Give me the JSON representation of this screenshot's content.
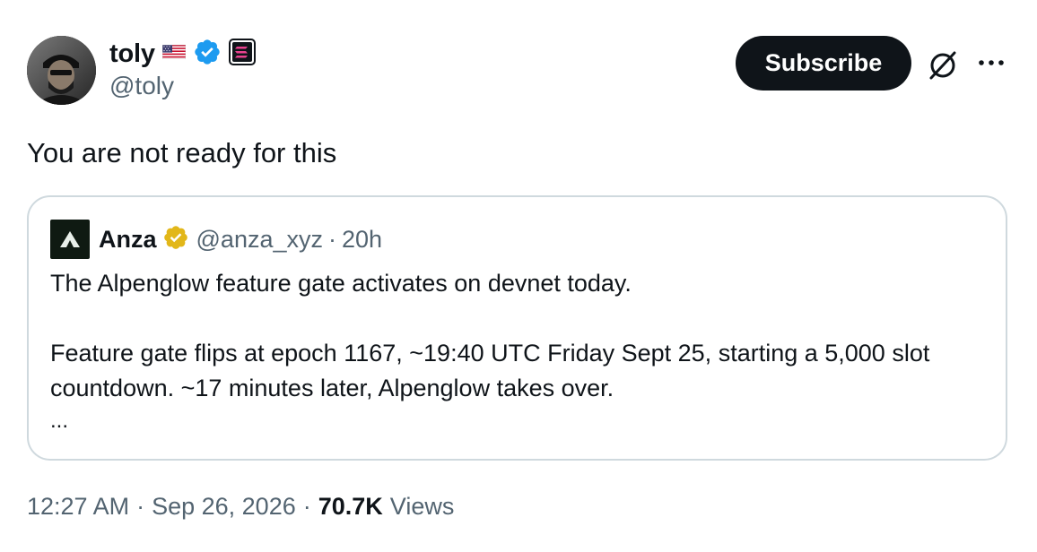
{
  "author": {
    "display_name": "toly",
    "handle": "@toly"
  },
  "header": {
    "subscribe_label": "Subscribe"
  },
  "tweet": {
    "text": "You are not ready for this"
  },
  "quote": {
    "display_name": "Anza",
    "handle": "@anza_xyz",
    "separator": "·",
    "time": "20h",
    "paragraph_1": "The Alpenglow feature gate activates on devnet today.",
    "paragraph_2": "Feature gate flips at epoch 1167, ~19:40 UTC Friday Sept 25, starting a 5,000 slot countdown. ~17 minutes later, Alpenglow takes over.",
    "ellipsis": "..."
  },
  "meta": {
    "time": "12:27 AM",
    "separator": "·",
    "date": "Sep 26, 2026",
    "views_count": "70.7K",
    "views_label": "Views"
  },
  "icons": {
    "flag": "us-flag-icon",
    "verified": "blue-verified-badge-icon",
    "affiliate": "solana-logo-icon",
    "quote_verified": "gold-verified-badge-icon",
    "grok": "grok-icon",
    "more": "more-dots-icon"
  },
  "colors": {
    "text_primary": "#0f1419",
    "text_secondary": "#536471",
    "verified_blue": "#1d9bf0",
    "verified_gold": "#e2b719",
    "border": "#cfd9de",
    "button_bg": "#0f1419"
  }
}
